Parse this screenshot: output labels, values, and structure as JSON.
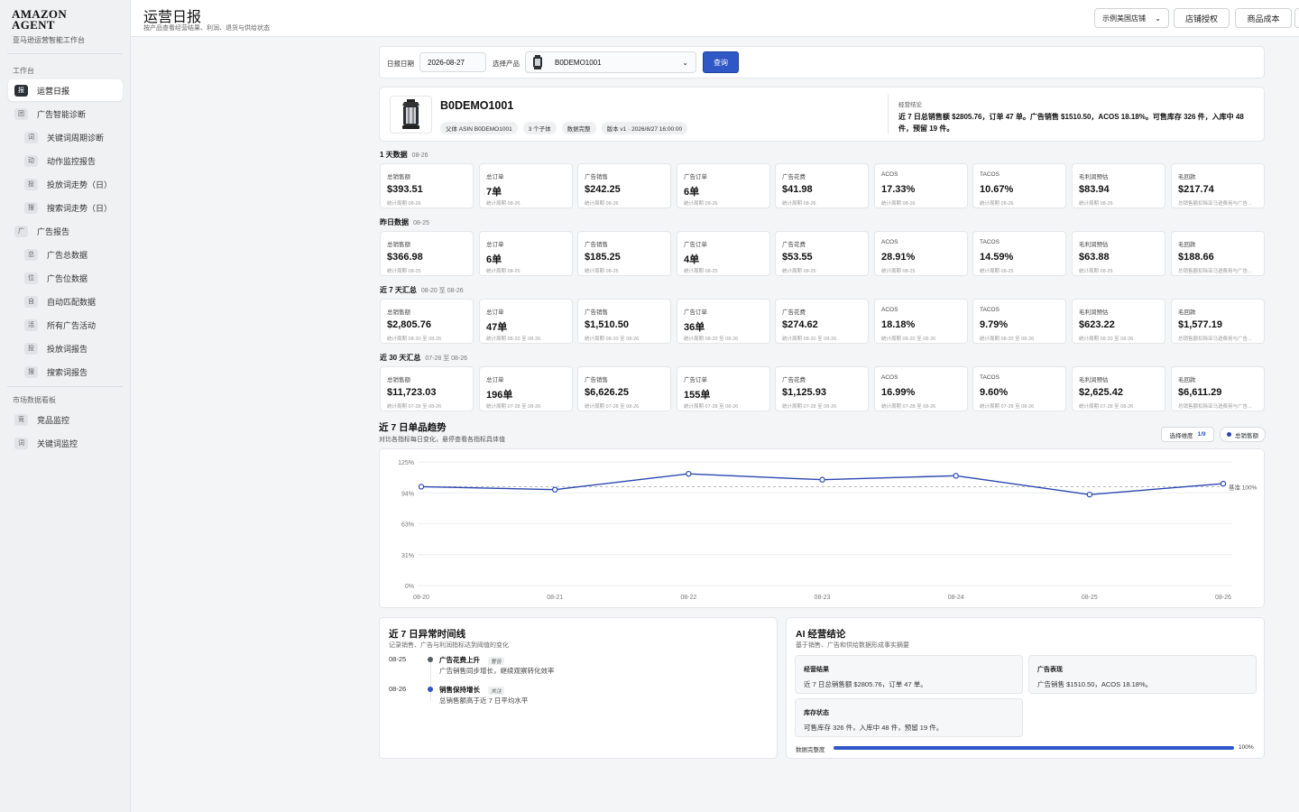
{
  "brand": {
    "line1": "AMAZON",
    "line2": "AGENT",
    "sub": "亚马逊运营智能工作台"
  },
  "sidebar": {
    "section_work": "工作台",
    "section_market": "市场数据看板",
    "items": [
      {
        "icon": "报",
        "label": "运营日报",
        "active": true
      },
      {
        "icon": "团",
        "label": "广告智能诊断"
      },
      {
        "icon": "词",
        "label": "关键词周期诊断"
      },
      {
        "icon": "动",
        "label": "动作监控报告"
      },
      {
        "icon": "投",
        "label": "投放词走势（日）"
      },
      {
        "icon": "搜",
        "label": "搜索词走势（日）"
      },
      {
        "icon": "广",
        "label": "广告报告"
      },
      {
        "icon": "总",
        "label": "广告总数据"
      },
      {
        "icon": "位",
        "label": "广告位数据"
      },
      {
        "icon": "自",
        "label": "自动匹配数据"
      },
      {
        "icon": "活",
        "label": "所有广告活动"
      },
      {
        "icon": "投",
        "label": "投放词报告"
      },
      {
        "icon": "搜",
        "label": "搜索词报告"
      },
      {
        "icon": "竞",
        "label": "竞品监控"
      },
      {
        "icon": "词",
        "label": "关键词监控"
      }
    ]
  },
  "header": {
    "title": "运营日报",
    "subtitle": "按产品查看经营结果、利润、退货与供给状态",
    "store": "示例美国店铺",
    "btn_auth": "店铺授权",
    "btn_cost": "商品成本"
  },
  "filter": {
    "date_label": "日报日期",
    "date_value": "2026-08-27",
    "product_label": "选择产品",
    "product_value": "B0DEMO1001",
    "query": "查询"
  },
  "product": {
    "asin": "B0DEMO1001",
    "tags": [
      "父体 ASIN B0DEMO1001",
      "3 个子体",
      "数据完整",
      "版本 v1 · 2026/8/27 16:00:00"
    ],
    "conclusion_label": "经营结论",
    "conclusion": "近 7 日总销售额 $2805.76，订单 47 单。广告销售 $1510.50，ACOS 18.18%。可售库存 326 件，入库中 48 件，预留 19 件。"
  },
  "metric_labels": [
    "总销售额",
    "总订单",
    "广告销售",
    "广告订单",
    "广告花费",
    "ACOS",
    "TACOS",
    "毛利润预估",
    "毛回款"
  ],
  "metric_groups": [
    {
      "title": "1 天数据",
      "date": "08-26",
      "note": "统计周期 08-26",
      "last_note": "总销售额扣除亚马逊费用与广告...",
      "values": [
        "$393.51",
        "7单",
        "$242.25",
        "6单",
        "$41.98",
        "17.33%",
        "10.67%",
        "$83.94",
        "$217.74"
      ]
    },
    {
      "title": "昨日数据",
      "date": "08-25",
      "note": "统计周期 08-25",
      "last_note": "总销售额扣除亚马逊费用与广告...",
      "values": [
        "$366.98",
        "6单",
        "$185.25",
        "4单",
        "$53.55",
        "28.91%",
        "14.59%",
        "$63.88",
        "$188.66"
      ]
    },
    {
      "title": "近 7 天汇总",
      "date": "08-20 至 08-26",
      "note": "统计周期 08-20 至 08-26",
      "last_note": "总销售额扣除亚马逊费用与广告...",
      "values": [
        "$2,805.76",
        "47单",
        "$1,510.50",
        "36单",
        "$274.62",
        "18.18%",
        "9.79%",
        "$623.22",
        "$1,577.19"
      ]
    },
    {
      "title": "近 30 天汇总",
      "date": "07-28 至 08-26",
      "note": "统计周期 07-28 至 08-26",
      "last_note": "总销售额扣除亚马逊费用与广告...",
      "values": [
        "$11,723.03",
        "196单",
        "$6,626.25",
        "155单",
        "$1,125.93",
        "16.99%",
        "9.60%",
        "$2,625.42",
        "$6,611.29"
      ]
    }
  ],
  "trend": {
    "title": "近 7 日单品趋势",
    "subtitle": "对比各指标每日变化，悬停查看各指标具体值",
    "dim_label": "选择维度",
    "dim_count": "1/9",
    "legend": "总销售额",
    "baseline_label": "基准 100%"
  },
  "chart_data": {
    "type": "line",
    "x": [
      "08-20",
      "08-21",
      "08-22",
      "08-23",
      "08-24",
      "08-25",
      "08-26"
    ],
    "series": [
      {
        "name": "总销售额",
        "values": [
          100,
          97,
          113,
          107,
          111,
          92,
          103
        ]
      }
    ],
    "yticks": [
      "125%",
      "94%",
      "63%",
      "31%",
      "0%"
    ],
    "ylim": [
      0,
      125
    ],
    "baseline": 100,
    "grid": true,
    "color": "#2a46b0"
  },
  "timeline": {
    "title": "近 7 日异常时间线",
    "subtitle": "记录销售、广告与利润指标达到阈值的变化",
    "events": [
      {
        "date": "08-25",
        "title": "广告花费上升",
        "badge": "警告",
        "desc": "广告销售同步增长，继续观察转化效率",
        "color": "#555c66"
      },
      {
        "date": "08-26",
        "title": "销售保持增长",
        "badge": "关注",
        "desc": "总销售额高于近 7 日平均水平",
        "color": "#2f57c5"
      }
    ]
  },
  "ai": {
    "title": "AI 经营结论",
    "subtitle": "基于销售、广告和供给数据形成事实摘要",
    "boxes": [
      {
        "h": "经营结果",
        "t": "近 7 日总销售额 $2805.76，订单 47 单。"
      },
      {
        "h": "广告表现",
        "t": "广告销售 $1510.50，ACOS 18.18%。"
      },
      {
        "h": "库存状态",
        "t": "可售库存 326 件，入库中 48 件，预留 19 件。"
      }
    ],
    "completeness_label": "数据完整度",
    "completeness_value": "100%",
    "completeness": 1.0
  }
}
